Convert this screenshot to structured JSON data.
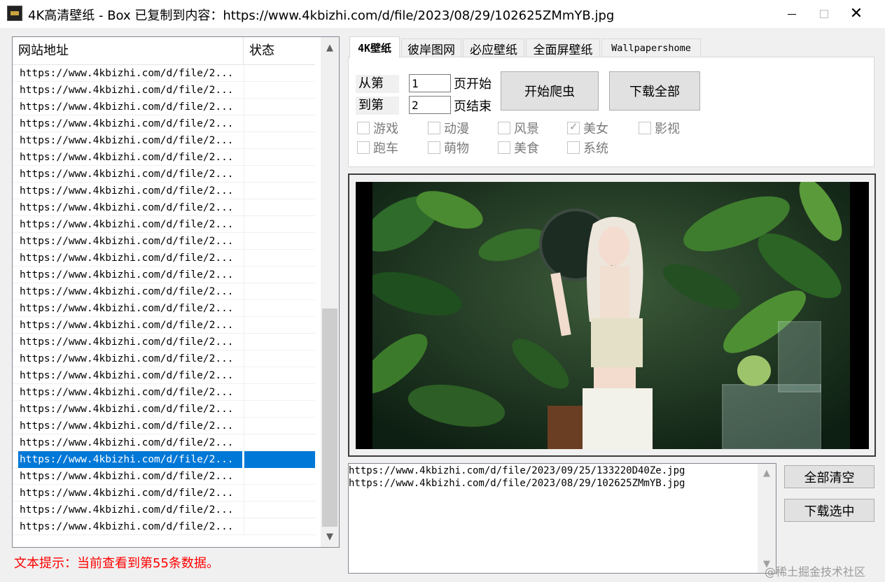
{
  "titlebar": {
    "title": "4K高清壁纸 - Box   已复制到内容：https://www.4kbizhi.com/d/file/2023/08/29/102625ZMmYB.jpg",
    "minimize": "",
    "maximize": "",
    "close": "✕"
  },
  "list": {
    "col_url": "网站地址",
    "col_status": "状态",
    "row_text": "https://www.4kbizhi.com/d/file/2...",
    "selected_index": 23,
    "scroll_up": "▲",
    "scroll_down": "▼"
  },
  "hint": "文本提示：当前查看到第55条数据。",
  "tabs": [
    "4K壁纸",
    "彼岸图网",
    "必应壁纸",
    "全面屏壁纸",
    "Wallpapershome"
  ],
  "form": {
    "from_label": "从第",
    "to_label": "到第",
    "from_value": "1",
    "to_value": "2",
    "from_suffix": "页开始",
    "to_suffix": "页结束",
    "start_button": "开始爬虫",
    "download_all_button": "下载全部"
  },
  "categories": [
    {
      "label": "游戏",
      "checked": false
    },
    {
      "label": "动漫",
      "checked": false
    },
    {
      "label": "风景",
      "checked": false
    },
    {
      "label": "美女",
      "checked": true
    },
    {
      "label": "影视",
      "checked": false
    },
    {
      "label": "跑车",
      "checked": false
    },
    {
      "label": "萌物",
      "checked": false
    },
    {
      "label": "美食",
      "checked": false
    },
    {
      "label": "系统",
      "checked": false
    }
  ],
  "log": {
    "lines": [
      "https://www.4kbizhi.com/d/file/2023/09/25/133220D40Ze.jpg",
      "https://www.4kbizhi.com/d/file/2023/08/29/102625ZMmYB.jpg"
    ]
  },
  "buttons": {
    "clear_all": "全部清空",
    "download_selected": "下载选中"
  },
  "watermark": "@稀土掘金技术社区",
  "colors": {
    "selection": "#0078d7",
    "hint_text": "#ff0000"
  }
}
